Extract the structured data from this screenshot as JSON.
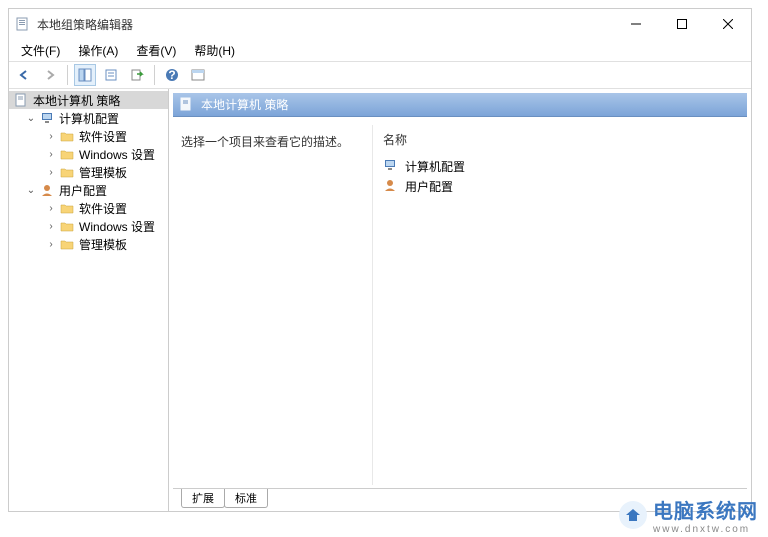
{
  "window": {
    "title": "本地组策略编辑器"
  },
  "menus": {
    "file": "文件(F)",
    "action": "操作(A)",
    "view": "查看(V)",
    "help": "帮助(H)"
  },
  "tree": {
    "root": "本地计算机 策略",
    "computer_config": "计算机配置",
    "user_config": "用户配置",
    "software_settings": "软件设置",
    "windows_settings": "Windows 设置",
    "admin_templates": "管理模板"
  },
  "right": {
    "header": "本地计算机 策略",
    "description": "选择一个项目来查看它的描述。",
    "column_name": "名称",
    "items": {
      "computer": "计算机配置",
      "user": "用户配置"
    }
  },
  "tabs": {
    "extended": "扩展",
    "standard": "标准"
  },
  "watermark": {
    "title": "电脑系统网",
    "url": "www.dnxtw.com"
  }
}
